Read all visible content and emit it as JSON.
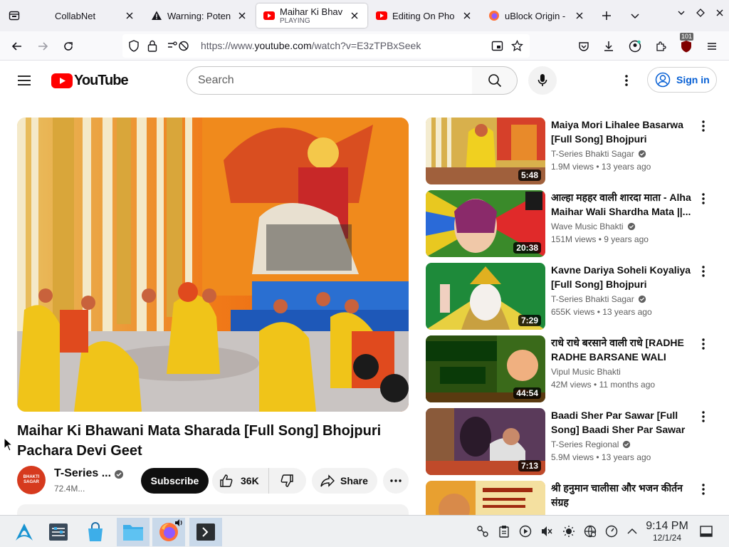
{
  "browser": {
    "tabs": [
      {
        "title": "CollabNet",
        "subtitle": "",
        "active": false,
        "favicon": "collabnet-icon"
      },
      {
        "title": "Warning: Poten",
        "subtitle": "",
        "active": false,
        "favicon": "warning-icon"
      },
      {
        "title": "Maihar Ki Bhav",
        "subtitle": "PLAYING",
        "active": true,
        "favicon": "youtube-icon"
      },
      {
        "title": "Editing On Pho",
        "subtitle": "",
        "active": false,
        "favicon": "youtube-icon"
      },
      {
        "title": "uBlock Origin -",
        "subtitle": "",
        "active": false,
        "favicon": "firefox-icon"
      }
    ],
    "url_prefix": "https://www.",
    "url_host": "youtube.com",
    "url_path": "/watch?v=E3zTPBxSeek",
    "extension_badge": "101"
  },
  "youtube": {
    "logo_text": "YouTube",
    "search_placeholder": "Search",
    "sign_in": "Sign in",
    "video": {
      "title": "Maihar Ki Bhawani Mata Sharada [Full Song] Bhojpuri Pachara Devi Geet",
      "channel": "T-Series ...",
      "subscribers": "72.4M...",
      "subscribe_label": "Subscribe",
      "likes": "36K",
      "share_label": "Share",
      "avatar_text": "BHAKTI SAGAR"
    },
    "recommendations": [
      {
        "title": "Maiya Mori Lihalee Basarwa [Full Song] Bhojpuri Pachara...",
        "channel": "T-Series Bhakti Sagar",
        "verified": true,
        "views": "1.9M views",
        "age": "13 years ago",
        "duration": "5:48"
      },
      {
        "title": "आल्हा महहर वाली शारदा माता - Alha Maihar Wali Shardha Mata ||...",
        "channel": "Wave Music Bhakti",
        "verified": true,
        "views": "151M views",
        "age": "9 years ago",
        "duration": "20:38"
      },
      {
        "title": "Kavne Dariya Soheli Koyaliya [Full Song] Bhojpuri Pachara...",
        "channel": "T-Series Bhakti Sagar",
        "verified": true,
        "views": "655K views",
        "age": "13 years ago",
        "duration": "7:29"
      },
      {
        "title": "राधे राधे बरसाने वाली राधे [RADHE RADHE BARSANE WALI RADH...",
        "channel": "Vipul Music Bhakti",
        "verified": false,
        "views": "42M views",
        "age": "11 months ago",
        "duration": "44:54"
      },
      {
        "title": "Baadi Sher Par Sawar [Full Song] Baadi Sher Par Sawar",
        "channel": "T-Series Regional",
        "verified": true,
        "views": "5.9M views",
        "age": "13 years ago",
        "duration": "7:13"
      },
      {
        "title": "श्री हनुमान चालीसा और भजन कीर्तन संग्रह",
        "channel": "",
        "verified": false,
        "views": "",
        "age": "",
        "duration": ""
      }
    ]
  },
  "taskbar": {
    "time": "9:14 PM",
    "date": "12/1/24"
  },
  "colors": {
    "youtube_red": "#ff0000",
    "link_blue": "#065fd4",
    "tab_bar": "#f0f0f4"
  }
}
